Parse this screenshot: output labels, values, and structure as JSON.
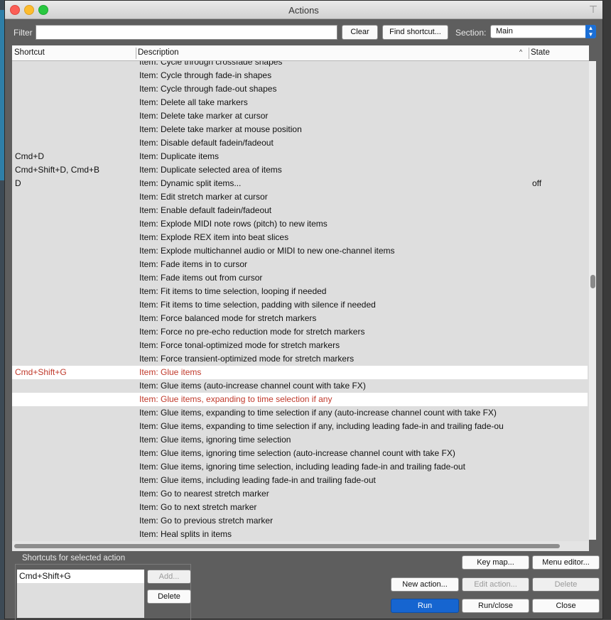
{
  "window": {
    "title": "Actions"
  },
  "filter": {
    "label": "Filter",
    "value": ""
  },
  "buttons": {
    "clear": "Clear",
    "find_shortcut": "Find shortcut...",
    "add": "Add...",
    "delete_shortcut": "Delete",
    "key_map": "Key map...",
    "menu_editor": "Menu editor...",
    "new_action": "New action...",
    "edit_action": "Edit action...",
    "delete_action": "Delete",
    "run": "Run",
    "run_close": "Run/close",
    "close": "Close"
  },
  "section": {
    "label": "Section:",
    "value": "Main"
  },
  "columns": {
    "shortcut": "Shortcut",
    "description": "Description",
    "state": "State"
  },
  "rows": [
    {
      "shortcut": "",
      "description": "Item: Cycle through crossfade shapes",
      "state": "",
      "selected": false
    },
    {
      "shortcut": "",
      "description": "Item: Cycle through fade-in shapes",
      "state": "",
      "selected": false
    },
    {
      "shortcut": "",
      "description": "Item: Cycle through fade-out shapes",
      "state": "",
      "selected": false
    },
    {
      "shortcut": "",
      "description": "Item: Delete all take markers",
      "state": "",
      "selected": false
    },
    {
      "shortcut": "",
      "description": "Item: Delete take marker at cursor",
      "state": "",
      "selected": false
    },
    {
      "shortcut": "",
      "description": "Item: Delete take marker at mouse position",
      "state": "",
      "selected": false
    },
    {
      "shortcut": "",
      "description": "Item: Disable default fadein/fadeout",
      "state": "",
      "selected": false
    },
    {
      "shortcut": "Cmd+D",
      "description": "Item: Duplicate items",
      "state": "",
      "selected": false
    },
    {
      "shortcut": "Cmd+Shift+D, Cmd+B",
      "description": "Item: Duplicate selected area of items",
      "state": "",
      "selected": false
    },
    {
      "shortcut": "D",
      "description": "Item: Dynamic split items...",
      "state": "off",
      "selected": false
    },
    {
      "shortcut": "",
      "description": "Item: Edit stretch marker at cursor",
      "state": "",
      "selected": false
    },
    {
      "shortcut": "",
      "description": "Item: Enable default fadein/fadeout",
      "state": "",
      "selected": false
    },
    {
      "shortcut": "",
      "description": "Item: Explode MIDI note rows (pitch) to new items",
      "state": "",
      "selected": false
    },
    {
      "shortcut": "",
      "description": "Item: Explode REX item into beat slices",
      "state": "",
      "selected": false
    },
    {
      "shortcut": "",
      "description": "Item: Explode multichannel audio or MIDI to new one-channel items",
      "state": "",
      "selected": false
    },
    {
      "shortcut": "",
      "description": "Item: Fade items in to cursor",
      "state": "",
      "selected": false
    },
    {
      "shortcut": "",
      "description": "Item: Fade items out from cursor",
      "state": "",
      "selected": false
    },
    {
      "shortcut": "",
      "description": "Item: Fit items to time selection, looping if needed",
      "state": "",
      "selected": false
    },
    {
      "shortcut": "",
      "description": "Item: Fit items to time selection, padding with silence if needed",
      "state": "",
      "selected": false
    },
    {
      "shortcut": "",
      "description": "Item: Force balanced mode for stretch markers",
      "state": "",
      "selected": false
    },
    {
      "shortcut": "",
      "description": "Item: Force no pre-echo reduction mode for stretch markers",
      "state": "",
      "selected": false
    },
    {
      "shortcut": "",
      "description": "Item: Force tonal-optimized mode for stretch markers",
      "state": "",
      "selected": false
    },
    {
      "shortcut": "",
      "description": "Item: Force transient-optimized mode for stretch markers",
      "state": "",
      "selected": false
    },
    {
      "shortcut": "Cmd+Shift+G",
      "description": "Item: Glue items",
      "state": "",
      "selected": true
    },
    {
      "shortcut": "",
      "description": "Item: Glue items (auto-increase channel count with take FX)",
      "state": "",
      "selected": false
    },
    {
      "shortcut": "",
      "description": "Item: Glue items, expanding to time selection if any",
      "state": "",
      "selected": true
    },
    {
      "shortcut": "",
      "description": "Item: Glue items, expanding to time selection if any (auto-increase channel count with take FX)",
      "state": "",
      "selected": false
    },
    {
      "shortcut": "",
      "description": "Item: Glue items, expanding to time selection if any, including leading fade-in and trailing fade-ou",
      "state": "",
      "selected": false
    },
    {
      "shortcut": "",
      "description": "Item: Glue items, ignoring time selection",
      "state": "",
      "selected": false
    },
    {
      "shortcut": "",
      "description": "Item: Glue items, ignoring time selection (auto-increase channel count with take FX)",
      "state": "",
      "selected": false
    },
    {
      "shortcut": "",
      "description": "Item: Glue items, ignoring time selection, including leading fade-in and trailing fade-out",
      "state": "",
      "selected": false
    },
    {
      "shortcut": "",
      "description": "Item: Glue items, including leading fade-in and trailing fade-out",
      "state": "",
      "selected": false
    },
    {
      "shortcut": "",
      "description": "Item: Go to nearest stretch marker",
      "state": "",
      "selected": false
    },
    {
      "shortcut": "",
      "description": "Item: Go to next stretch marker",
      "state": "",
      "selected": false
    },
    {
      "shortcut": "",
      "description": "Item: Go to previous stretch marker",
      "state": "",
      "selected": false
    },
    {
      "shortcut": "",
      "description": "Item: Heal splits in items",
      "state": "",
      "selected": false
    }
  ],
  "shortcuts_panel": {
    "title": "Shortcuts for selected action",
    "items": [
      "Cmd+Shift+G"
    ]
  },
  "colors": {
    "selected_text": "#c0392b",
    "run_button": "#1665d0"
  }
}
